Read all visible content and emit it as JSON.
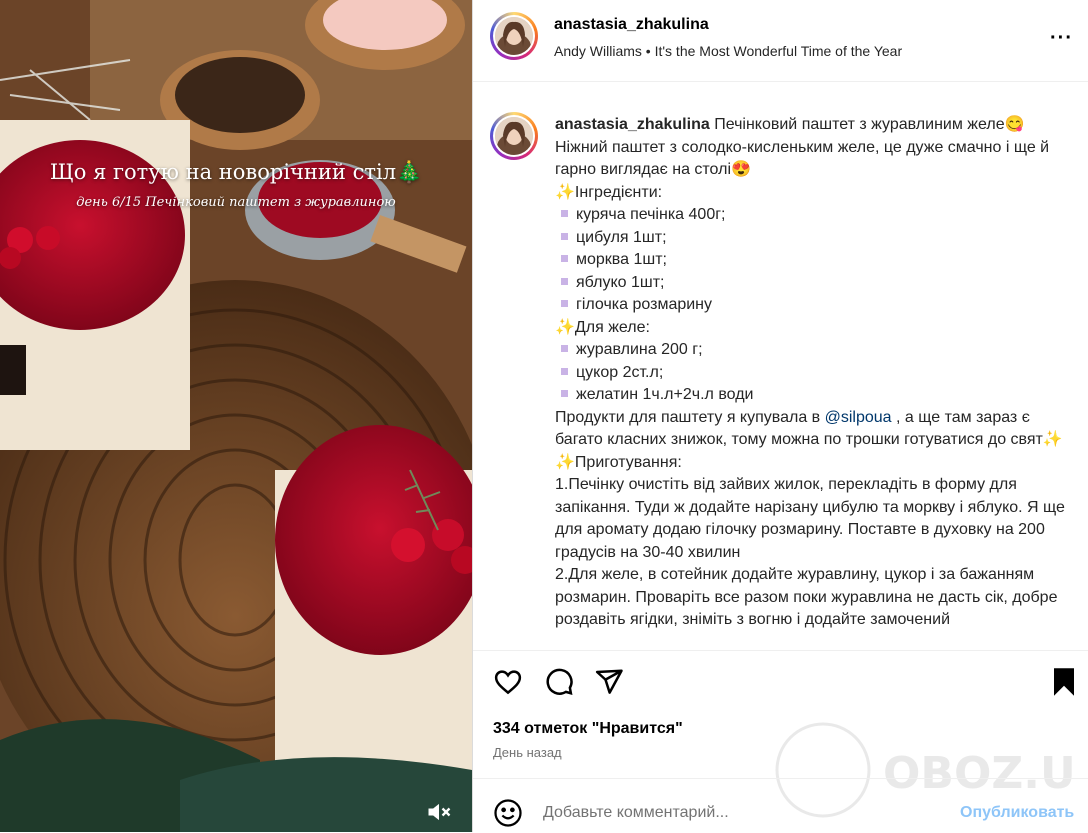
{
  "media": {
    "overlay_title": "Що я готую на новорічний стіл🎄",
    "overlay_subtitle": "день 6/15 Печінковий паштет з журавлиною",
    "mute_icon": "speaker-muted-icon"
  },
  "header": {
    "username": "anastasia_zhakulina",
    "song": "Andy Williams • It's the Most Wonderful Time of the Year",
    "more_icon": "more-horizontal-icon"
  },
  "caption": {
    "username": "anastasia_zhakulina",
    "line1": " Печінковий паштет з журавлиним желе😋",
    "line2": "Ніжний паштет з солодко-кисленьким желе, це дуже смачно і ще й гарно виглядає на столі😍",
    "ingredients_header": "Інгредієнти:",
    "ingredients": [
      "куряча печінка 400г;",
      "цибуля 1шт;",
      "морква 1шт;",
      "яблуко 1шт;",
      "гілочка розмарину"
    ],
    "jelly_header": "Для желе:",
    "jelly": [
      "журавлина 200 г;",
      "цукор 2ст.л;",
      "желатин 1ч.л+2ч.л води"
    ],
    "products_before": "Продукти для паштету я купувала в ",
    "mention": "@silpoua",
    "products_after": " , а ще там зараз є багато класних знижок, тому можна по трошки готуватися до свят",
    "prep_header": "Приготування:",
    "step1": "1.Печінку очистіть від зайвих жилок, перекладіть в форму для запікання. Туди ж додайте нарізану цибулю та моркву і яблуко. Я ще для аромату додаю гілочку розмарину. Поставте в духовку на 200 градусів на 30-40 хвилин",
    "step2": "2.Для желе, в сотейник додайте журавлину, цукор і за бажанням розмарин. Проваріть все разом поки журавлина не дасть сік, добре роздавіть ягідки, зніміть з вогню і додайте замочений"
  },
  "actions": {
    "like_icon": "heart-icon",
    "comment_icon": "comment-icon",
    "share_icon": "share-icon",
    "save_icon": "bookmark-icon"
  },
  "likes": "334 отметок \"Нравится\"",
  "time": "День назад",
  "comment": {
    "emoji_icon": "emoji-icon",
    "placeholder": "Добавьте комментарий...",
    "publish_label": "Опубликовать"
  },
  "watermark": {
    "text": "OBOZ.UA"
  },
  "colors": {
    "accent_link": "#00376b",
    "publish_disabled": "#8ec5f8",
    "secondary_text": "#737373"
  }
}
